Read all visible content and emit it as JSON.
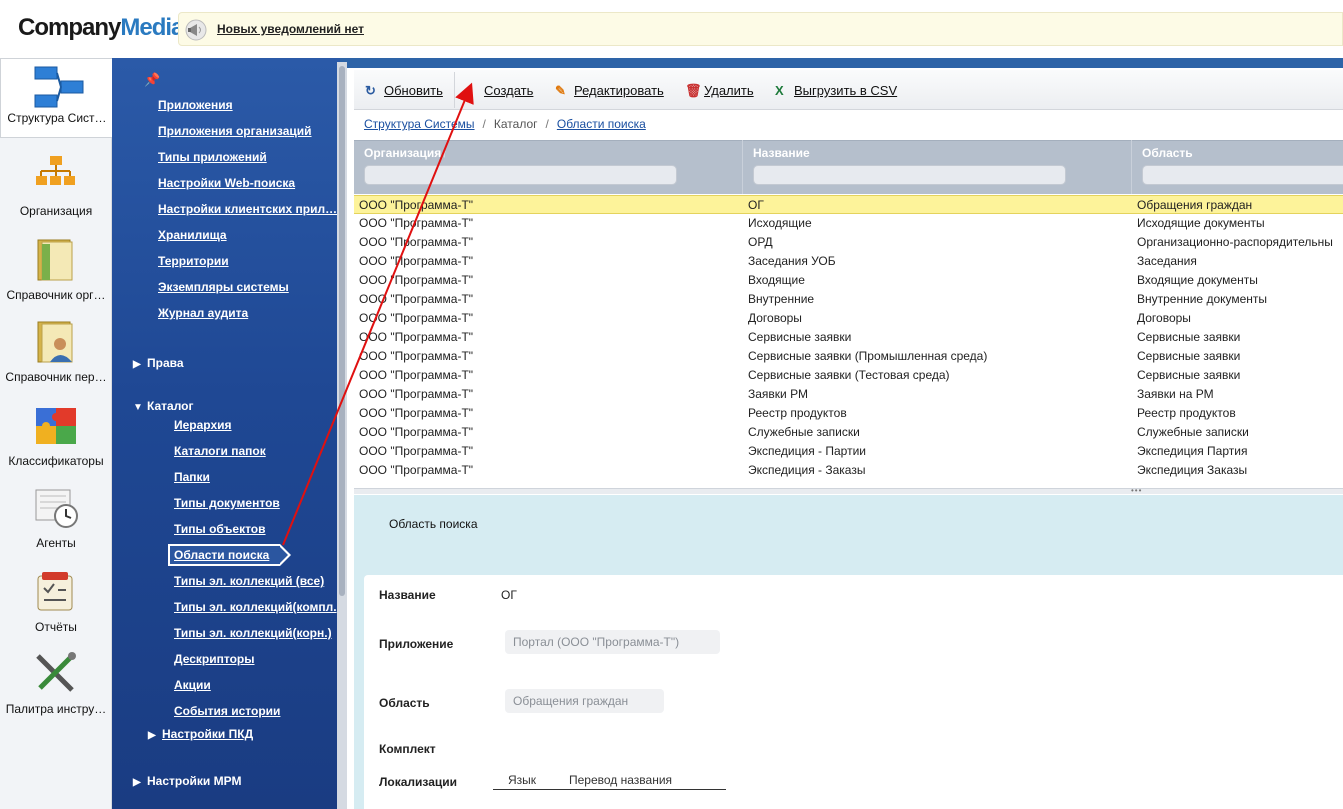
{
  "header": {
    "logo_company": "Company",
    "logo_media": "Media",
    "notification_text": "Новых уведомлений нет"
  },
  "rail": {
    "items": [
      {
        "label": "Структура Сист…",
        "icon": "structure-icon"
      },
      {
        "label": "Организация",
        "icon": "organization-icon"
      },
      {
        "label": "Справочник орг…",
        "icon": "org-directory-icon"
      },
      {
        "label": "Справочник пер…",
        "icon": "person-directory-icon"
      },
      {
        "label": "Классификаторы",
        "icon": "puzzle-icon"
      },
      {
        "label": "Агенты",
        "icon": "agents-clock-icon"
      },
      {
        "label": "Отчёты",
        "icon": "reports-icon"
      },
      {
        "label": "Палитра инстру…",
        "icon": "tools-icon"
      }
    ]
  },
  "nav": {
    "links": [
      "Приложения",
      "Приложения организаций",
      "Типы приложений",
      "Настройки Web-поиска",
      "Настройки клиентских прил…",
      "Хранилища",
      "Территории",
      "Экземпляры системы",
      "Журнал аудита"
    ],
    "section_rights": "Права",
    "section_catalog": "Каталог",
    "catalog_items": [
      "Иерархия",
      "Каталоги папок",
      "Папки",
      "Типы документов",
      "Типы объектов",
      "Области поиска",
      "Типы эл. коллекций (все)",
      "Типы эл. коллекций(компл.",
      "Типы эл. коллекций(корн.)",
      "Дескрипторы",
      "Акции",
      "События истории"
    ],
    "sub_section_pkd": "Настройки ПКД",
    "section_mrm": "Настройки МРМ"
  },
  "toolbar": {
    "refresh": "Обновить",
    "create": "Создать",
    "edit": "Редактировать",
    "delete": "Удалить",
    "export_csv": "Выгрузить в CSV"
  },
  "breadcrumb": {
    "item1": "Структура Системы",
    "item2": "Каталог",
    "item3": "Области поиска"
  },
  "grid": {
    "columns": [
      "Организация↑",
      "Название",
      "Область"
    ],
    "rows": [
      [
        "ООО \"Программа-Т\"",
        "ОГ",
        "Обращения граждан"
      ],
      [
        "ООО \"Программа-Т\"",
        "Исходящие",
        "Исходящие документы"
      ],
      [
        "ООО \"Программа-Т\"",
        "ОРД",
        "Организационно-распорядительны"
      ],
      [
        "ООО \"Программа-Т\"",
        "Заседания УОБ",
        "Заседания"
      ],
      [
        "ООО \"Программа-Т\"",
        "Входящие",
        "Входящие документы"
      ],
      [
        "ООО \"Программа-Т\"",
        "Внутренние",
        "Внутренние документы"
      ],
      [
        "ООО \"Программа-Т\"",
        "Договоры",
        "Договоры"
      ],
      [
        "ООО \"Программа-Т\"",
        "Сервисные заявки",
        "Сервисные заявки"
      ],
      [
        "ООО \"Программа-Т\"",
        "Сервисные заявки (Промышленная среда)",
        "Сервисные заявки"
      ],
      [
        "ООО \"Программа-Т\"",
        "Сервисные заявки (Тестовая среда)",
        "Сервисные заявки"
      ],
      [
        "ООО \"Программа-Т\"",
        "Заявки РМ",
        "Заявки на РМ"
      ],
      [
        "ООО \"Программа-Т\"",
        "Реестр продуктов",
        "Реестр продуктов"
      ],
      [
        "ООО \"Программа-Т\"",
        "Служебные записки",
        "Служебные записки"
      ],
      [
        "ООО \"Программа-Т\"",
        "Экспедиция - Партии",
        "Экспедиция Партия"
      ],
      [
        "ООО \"Программа-Т\"",
        "Экспедиция - Заказы",
        "Экспедиция Заказы"
      ]
    ]
  },
  "detail": {
    "title": "Область поиска",
    "name_label": "Название",
    "name_value": "ОГ",
    "app_label": "Приложение",
    "app_value": "Портал (ООО \"Программа-Т\")",
    "area_label": "Область",
    "area_value": "Обращения граждан",
    "kit_label": "Комплект",
    "loc_label": "Локализации",
    "loc_tab_lang": "Язык",
    "loc_tab_translation": "Перевод названия"
  },
  "colors": {
    "nav_bg": "#1f4894",
    "selected_row": "#fdf39a",
    "annotation_arrow": "#e01010"
  }
}
